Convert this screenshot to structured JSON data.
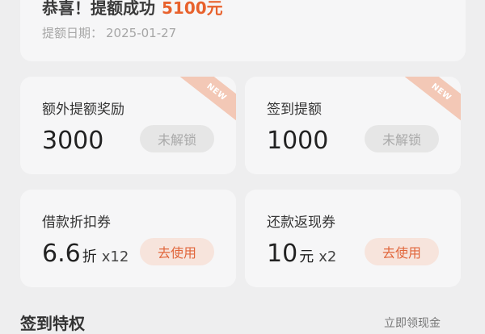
{
  "banner": {
    "headline": "恭喜！提额成功",
    "amount": "5100元",
    "date_label": "提额日期：",
    "date_value": "2025-01-27"
  },
  "cards": [
    {
      "title": "额外提额奖励",
      "value": "3000",
      "unit": "",
      "multiplier": "",
      "button": "未解锁",
      "ribbon": "NEW"
    },
    {
      "title": "签到提额",
      "value": "1000",
      "unit": "",
      "multiplier": "",
      "button": "未解锁",
      "ribbon": "NEW"
    },
    {
      "title": "借款折扣券",
      "value": "6.6",
      "unit": "折",
      "multiplier": "x12",
      "button": "去使用",
      "ribbon": ""
    },
    {
      "title": "还款返现券",
      "value": "10",
      "unit": "元",
      "multiplier": "x2",
      "button": "去使用",
      "ribbon": ""
    }
  ],
  "section": {
    "title": "签到特权",
    "link": "立即领现金"
  },
  "colors": {
    "accent": "#e8612c",
    "use_button_bg": "#f7e4dc",
    "locked_button_bg": "#e6e6e6",
    "ribbon": "#f3c8b6"
  }
}
